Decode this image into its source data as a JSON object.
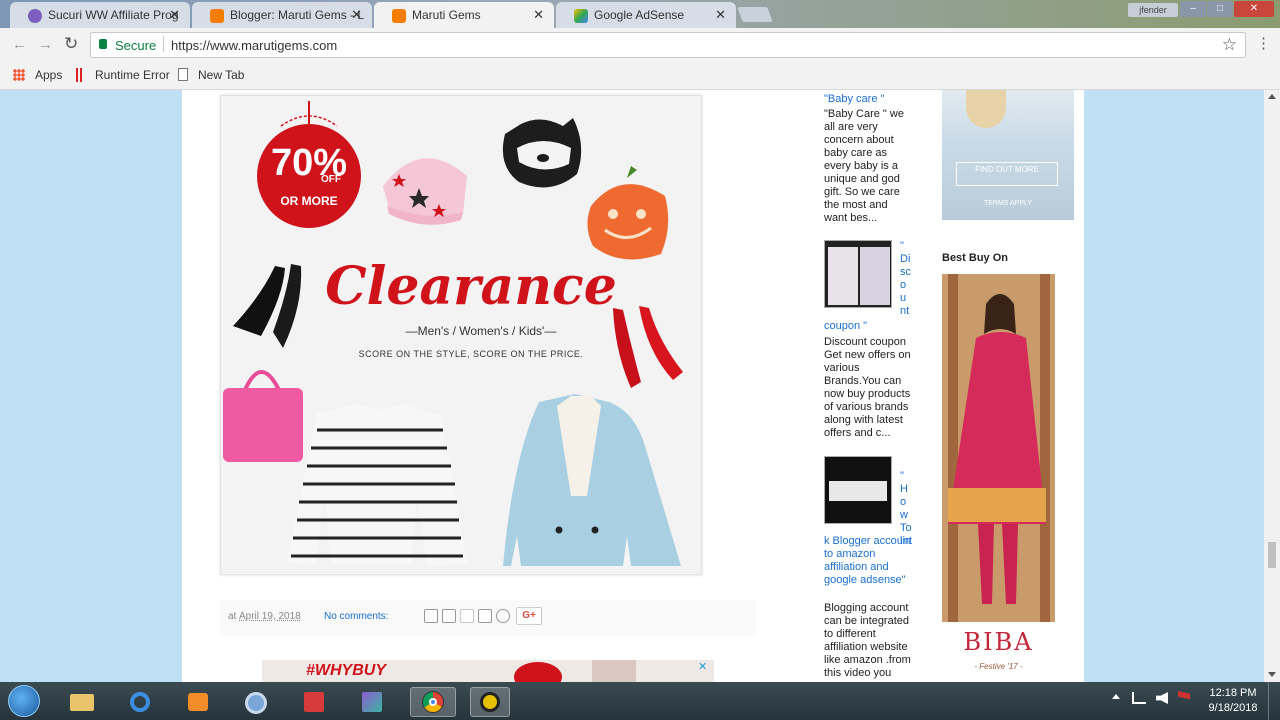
{
  "tabs": [
    {
      "title": "Sucuri WW Affiliate Prog",
      "close": "✕"
    },
    {
      "title": "Blogger: Maruti Gems - L",
      "close": "✕"
    },
    {
      "title": "Maruti Gems",
      "close": "✕"
    },
    {
      "title": "Google AdSense",
      "close": "✕"
    }
  ],
  "window": {
    "user": "jfender",
    "min": "–",
    "max": "□",
    "close": "✕"
  },
  "toolbar": {
    "back": "←",
    "forward": "→",
    "reload": "↻",
    "secure": "Secure",
    "url": "https://www.marutigems.com",
    "star": "☆",
    "menu": "⋮"
  },
  "bookmarks": {
    "apps": "Apps",
    "runtime_error": "Runtime Error",
    "new_tab": "New Tab"
  },
  "post": {
    "sale_percent": "70%",
    "sale_off": "OFF",
    "sale_more": "OR MORE",
    "headline": "Clearance",
    "subline": "—Men's / Women's / Kids'—",
    "tagline": "SCORE ON THE STYLE, SCORE ON THE PRICE.",
    "footer_at": "at",
    "footer_date": "April 19, 2018",
    "footer_comments": "No comments:",
    "share_gplus": "G+",
    "ad_text": "#WHYBUY",
    "ad_close": "✕"
  },
  "sidebar": {
    "item1_title": "\"Baby care \"",
    "item1_desc": "\"Baby Care \" we all are very concern about baby care as every baby is a unique and god gift. So we care the most and want bes...",
    "item2_title_a": "\" Di sc o u nt",
    "item2_title_b": "coupon \"",
    "item2_desc": "Discount coupon         Get new offers on various Brands.You can now buy products of various brands along with latest offers and c...",
    "item3_title_a": "\" H o w To lin",
    "item3_title_b": "k Blogger account to amazon affiliation and google adsense\"",
    "item3_desc": "Blogging account can be integrated to different affiliation website like amazon .from this video you"
  },
  "ads": {
    "find_out": "FIND OUT MORE",
    "terms": "TERMS APPLY",
    "best_buy": "Best Buy On",
    "biba": "BIBA",
    "biba_sub": "- Festive '17 -"
  },
  "taskbar": {
    "time": "12:18 PM",
    "date": "9/18/2018"
  }
}
